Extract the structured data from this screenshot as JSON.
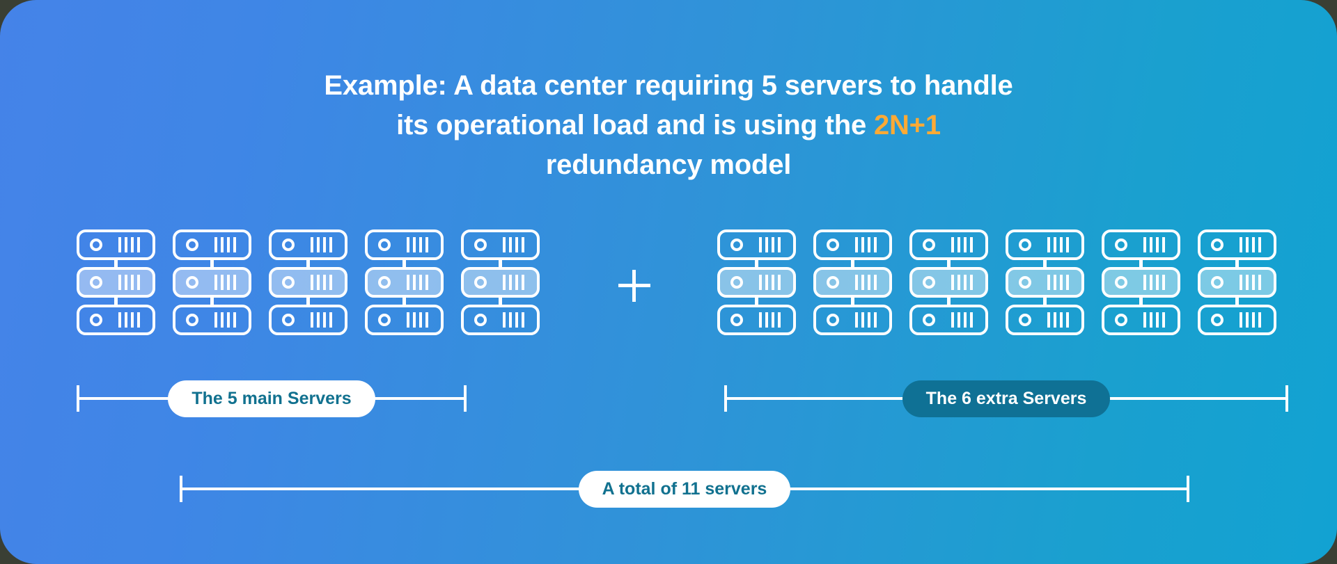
{
  "card": {
    "background_start": "#4583e8",
    "background_end": "#12a2d2",
    "accent_color": "#fcaa35",
    "pill_dark_color": "#0f7195",
    "pill_text_color": "#11718f"
  },
  "title": {
    "line1": "Example: A data center requiring 5 servers to handle",
    "line2_before": "its operational load and is using the ",
    "line2_accent": "2N+1",
    "line3": "redundancy model"
  },
  "diagram": {
    "operator": "+",
    "main_group": {
      "columns": 5,
      "rows": 3,
      "highlighted_row_index": 1
    },
    "extra_group": {
      "columns": 6,
      "rows": 3,
      "highlighted_row_index": 1
    },
    "server_icon": {
      "name": "server-icon",
      "dot": "status-led",
      "bars": 4
    }
  },
  "labels": {
    "main": "The 5 main Servers",
    "extra": "The 6 extra Servers",
    "total": "A total of 11 servers"
  }
}
